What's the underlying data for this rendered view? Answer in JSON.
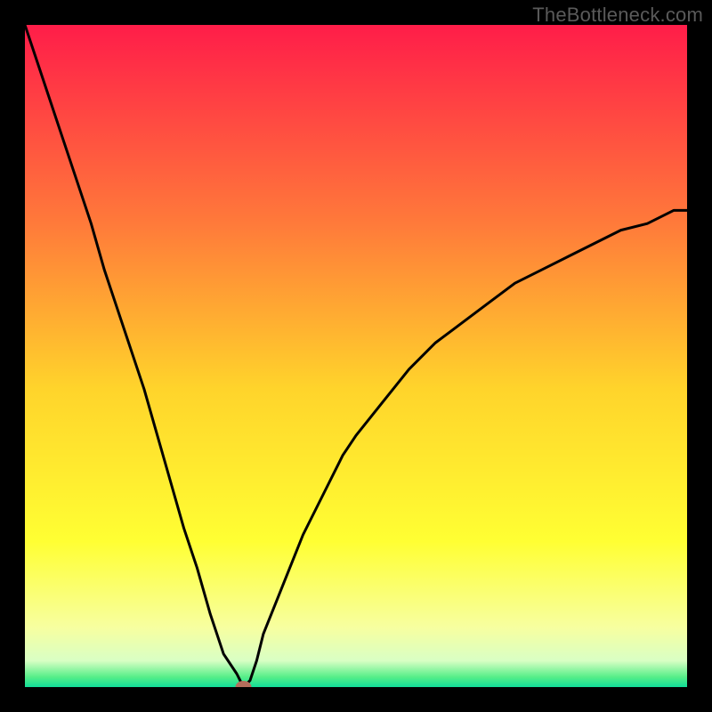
{
  "watermark": "TheBottleneck.com",
  "chart_data": {
    "type": "line",
    "title": "",
    "xlabel": "",
    "ylabel": "",
    "xlim": [
      0,
      100
    ],
    "ylim": [
      0,
      100
    ],
    "x": [
      0,
      2,
      4,
      6,
      8,
      10,
      12,
      14,
      16,
      18,
      20,
      22,
      24,
      26,
      28,
      30,
      32,
      33,
      34,
      35,
      36,
      38,
      40,
      42,
      44,
      46,
      48,
      50,
      54,
      58,
      62,
      66,
      70,
      74,
      78,
      82,
      86,
      90,
      94,
      98,
      100
    ],
    "y": [
      100,
      94,
      88,
      82,
      76,
      70,
      63,
      57,
      51,
      45,
      38,
      31,
      24,
      18,
      11,
      5,
      2,
      0,
      1,
      4,
      8,
      13,
      18,
      23,
      27,
      31,
      35,
      38,
      43,
      48,
      52,
      55,
      58,
      61,
      63,
      65,
      67,
      69,
      70,
      72,
      72
    ],
    "marker": {
      "x": 33,
      "y": 0,
      "color": "#b56e5c"
    },
    "gradient_stops": [
      {
        "t": 0.0,
        "color": "#ff1d49"
      },
      {
        "t": 0.3,
        "color": "#ff7a3a"
      },
      {
        "t": 0.55,
        "color": "#ffd42b"
      },
      {
        "t": 0.78,
        "color": "#ffff33"
      },
      {
        "t": 0.91,
        "color": "#f7ffa0"
      },
      {
        "t": 0.96,
        "color": "#d9ffc4"
      },
      {
        "t": 0.985,
        "color": "#55ee88"
      },
      {
        "t": 1.0,
        "color": "#11dd99"
      }
    ]
  }
}
